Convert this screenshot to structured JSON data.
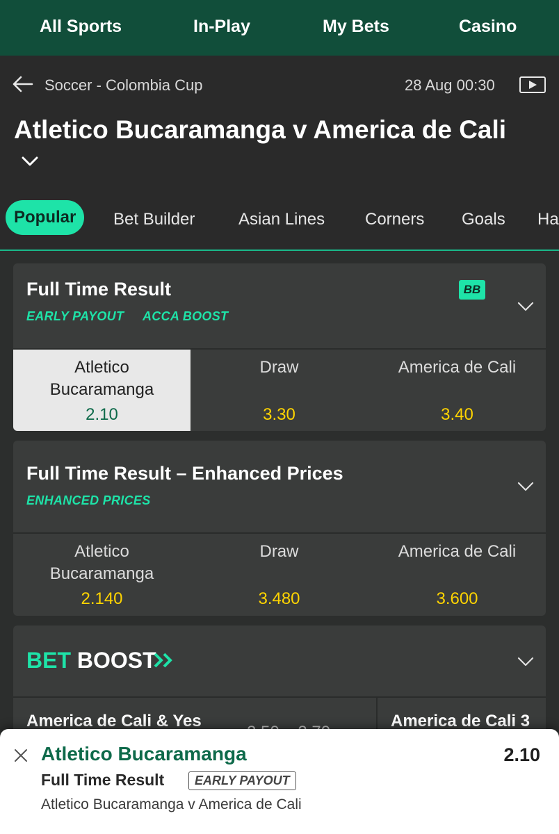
{
  "topnav": {
    "items": [
      {
        "label": "All Sports"
      },
      {
        "label": "In-Play"
      },
      {
        "label": "My Bets"
      },
      {
        "label": "Casino"
      }
    ]
  },
  "header": {
    "breadcrumb": "Soccer - Colombia Cup",
    "datetime": "28 Aug 00:30",
    "match_title": "Atletico Bucaramanga v America de Cali"
  },
  "tabs": [
    {
      "label": "Popular",
      "active": true
    },
    {
      "label": "Bet Builder"
    },
    {
      "label": "Asian Lines"
    },
    {
      "label": "Corners"
    },
    {
      "label": "Goals"
    },
    {
      "label": "Ha"
    }
  ],
  "markets": [
    {
      "title": "Full Time Result",
      "badges": [
        "EARLY PAYOUT",
        "ACCA BOOST"
      ],
      "bb_label": "BB",
      "selections": [
        {
          "name_line1": "Atletico",
          "name_line2": "Bucaramanga",
          "price": "2.10",
          "selected": true
        },
        {
          "name_line1": "Draw",
          "name_line2": "",
          "price": "3.30"
        },
        {
          "name_line1": "America de Cali",
          "name_line2": "",
          "price": "3.40"
        }
      ]
    },
    {
      "title": "Full Time Result – Enhanced Prices",
      "badges": [
        "ENHANCED PRICES"
      ],
      "selections": [
        {
          "name_line1": "Atletico",
          "name_line2": "Bucaramanga",
          "price": "2.140"
        },
        {
          "name_line1": "Draw",
          "name_line2": "",
          "price": "3.480"
        },
        {
          "name_line1": "America de Cali",
          "name_line2": "",
          "price": "3.600"
        }
      ]
    }
  ],
  "bet_boost": {
    "title_bet": "BET",
    "title_boost": "BOOST",
    "items": [
      {
        "label": "America de Cali & Yes",
        "odds": "2.50 » 2.70"
      },
      {
        "label": "America de Cali 3"
      }
    ]
  },
  "betslip": {
    "selection": "Atletico Bucaramanga",
    "odds": "2.10",
    "market": "Full Time Result",
    "badge": "EARLY PAYOUT",
    "event": "Atletico Bucaramanga v America de Cali"
  },
  "colors": {
    "nav_bg": "#114e3a",
    "accent": "#1ee3a8",
    "price": "#ffd400",
    "selected_price": "#0e6a4a"
  }
}
